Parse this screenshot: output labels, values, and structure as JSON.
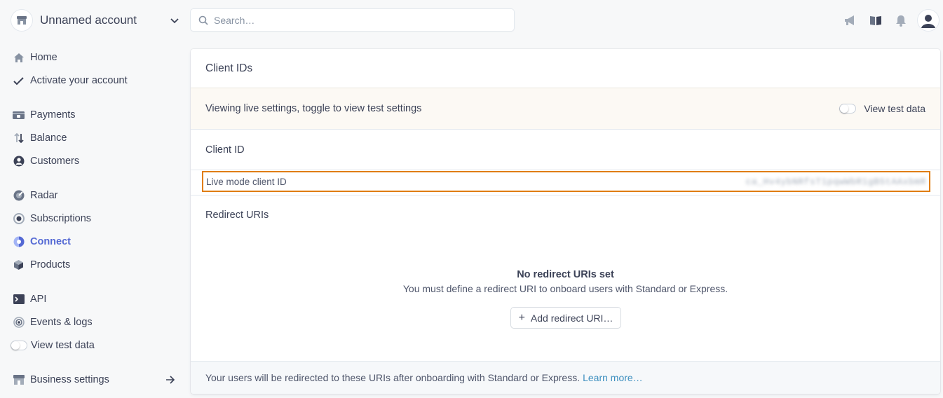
{
  "account": {
    "name": "Unnamed account"
  },
  "search": {
    "placeholder": "Search…"
  },
  "sidebar": {
    "items": [
      {
        "label": "Home",
        "icon": "home-icon"
      },
      {
        "label": "Activate your account",
        "icon": "check-icon"
      },
      {
        "label": "Payments",
        "icon": "payments-icon"
      },
      {
        "label": "Balance",
        "icon": "balance-icon"
      },
      {
        "label": "Customers",
        "icon": "customers-icon"
      },
      {
        "label": "Radar",
        "icon": "radar-icon"
      },
      {
        "label": "Subscriptions",
        "icon": "subscriptions-icon"
      },
      {
        "label": "Connect",
        "icon": "connect-icon",
        "active": true
      },
      {
        "label": "Products",
        "icon": "products-icon"
      },
      {
        "label": "API",
        "icon": "terminal-icon"
      },
      {
        "label": "Events & logs",
        "icon": "events-icon"
      },
      {
        "label": "View test data",
        "icon": "toggle"
      },
      {
        "label": "Business settings",
        "icon": "store-icon"
      }
    ]
  },
  "card": {
    "title": "Client IDs",
    "banner_text": "Viewing live settings, toggle to view test settings",
    "banner_toggle_label": "View test data",
    "client_id_heading": "Client ID",
    "live_label": "Live mode client ID",
    "live_value": "ca_Hv4ybNRfsT1pqwWbR1gB5tAAxbmR",
    "redirect_heading": "Redirect URIs",
    "empty_title": "No redirect URIs set",
    "empty_subtitle": "You must define a redirect URI to onboard users with Standard or Express.",
    "add_button": "Add redirect URI…",
    "footer_text": "Your users will be redirected to these URIs after onboarding with Standard or Express.",
    "footer_link": "Learn more…"
  },
  "colors": {
    "accent": "#5469d4",
    "highlight_border": "#e07d10",
    "link": "#3d8fbf",
    "banner_bg": "#fcf9f4"
  }
}
